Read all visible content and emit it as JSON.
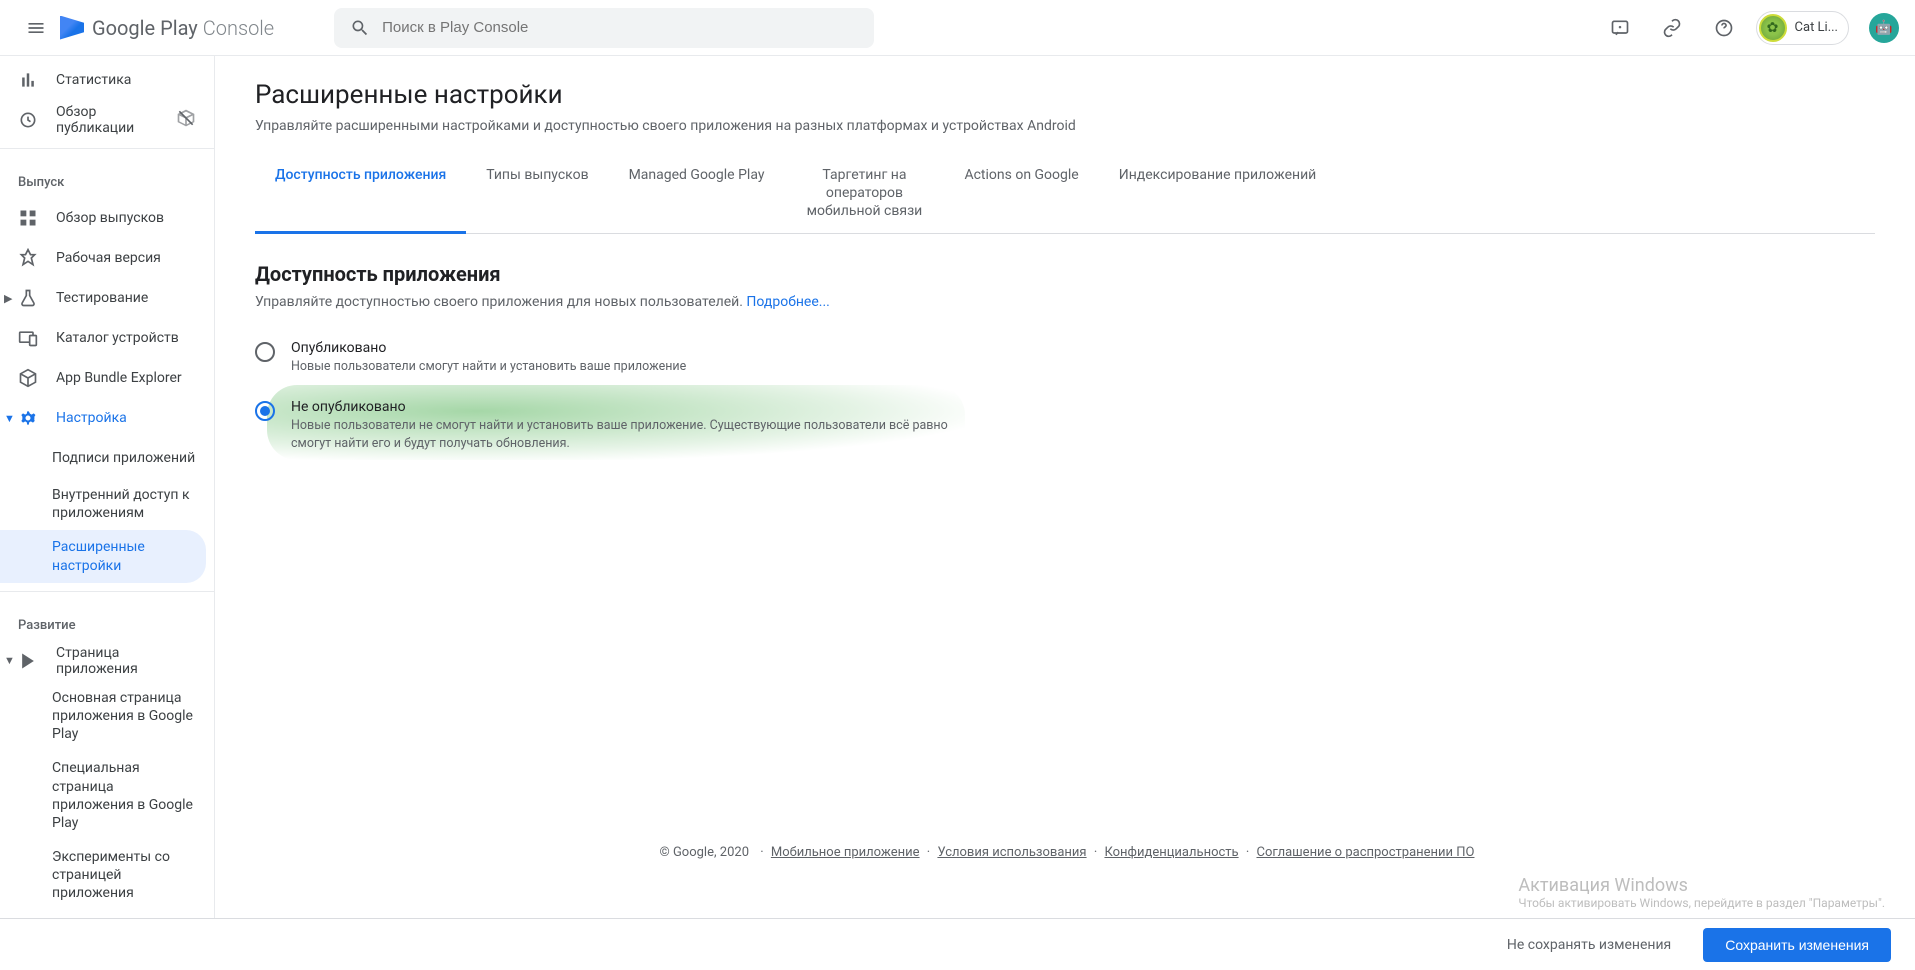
{
  "header": {
    "logo_text_1": "Google Play",
    "logo_text_2": "Console",
    "search_placeholder": "Поиск в Play Console",
    "account_name": "Cat Li..."
  },
  "sidebar": {
    "statistics": "Статистика",
    "publishing_overview": "Обзор публикации",
    "section_release": "Выпуск",
    "releases_overview": "Обзор выпусков",
    "production": "Рабочая версия",
    "testing": "Тестирование",
    "device_catalog": "Каталог устройств",
    "app_bundle": "App Bundle Explorer",
    "setup": "Настройка",
    "app_signing": "Подписи приложений",
    "internal_sharing": "Внутренний доступ к приложениям",
    "advanced_settings": "Расширенные настройки",
    "section_grow": "Развитие",
    "store_presence": "Страница приложения",
    "main_listing": "Основная страница приложения в Google Play",
    "custom_listing": "Специальная страница приложения в Google Play",
    "experiments": "Эксперименты со страницей приложения"
  },
  "page": {
    "title": "Расширенные настройки",
    "description": "Управляйте расширенными настройками и доступностью своего приложения на разных платформах и устройствах Android"
  },
  "tabs": {
    "availability": "Доступность приложения",
    "release_types": "Типы выпусков",
    "managed": "Managed Google Play",
    "targeting": "Таргетинг на операторов мобильной связи",
    "actions": "Actions on Google",
    "indexing": "Индексирование приложений"
  },
  "section": {
    "title": "Доступность приложения",
    "description": "Управляйте доступностью своего приложения для новых пользователей.",
    "learn_more": "Подробнее..."
  },
  "options": {
    "published": {
      "label": "Опубликовано",
      "desc": "Новые пользователи смогут найти и установить ваше приложение"
    },
    "unpublished": {
      "label": "Не опубликовано",
      "desc": "Новые пользователи не смогут найти и установить ваше приложение. Существующие пользователи всё равно смогут найти его и будут получать обновления."
    }
  },
  "footer": {
    "copyright": "© Google, 2020",
    "mobile": "Мобильное приложение",
    "terms": "Условия использования",
    "privacy": "Конфиденциальность",
    "distribution": "Соглашение о распространении ПО"
  },
  "windows": {
    "title": "Активация Windows",
    "sub": "Чтобы активировать Windows, перейдите в раздел \"Параметры\"."
  },
  "actions": {
    "discard": "Не сохранять изменения",
    "save": "Сохранить изменения"
  }
}
